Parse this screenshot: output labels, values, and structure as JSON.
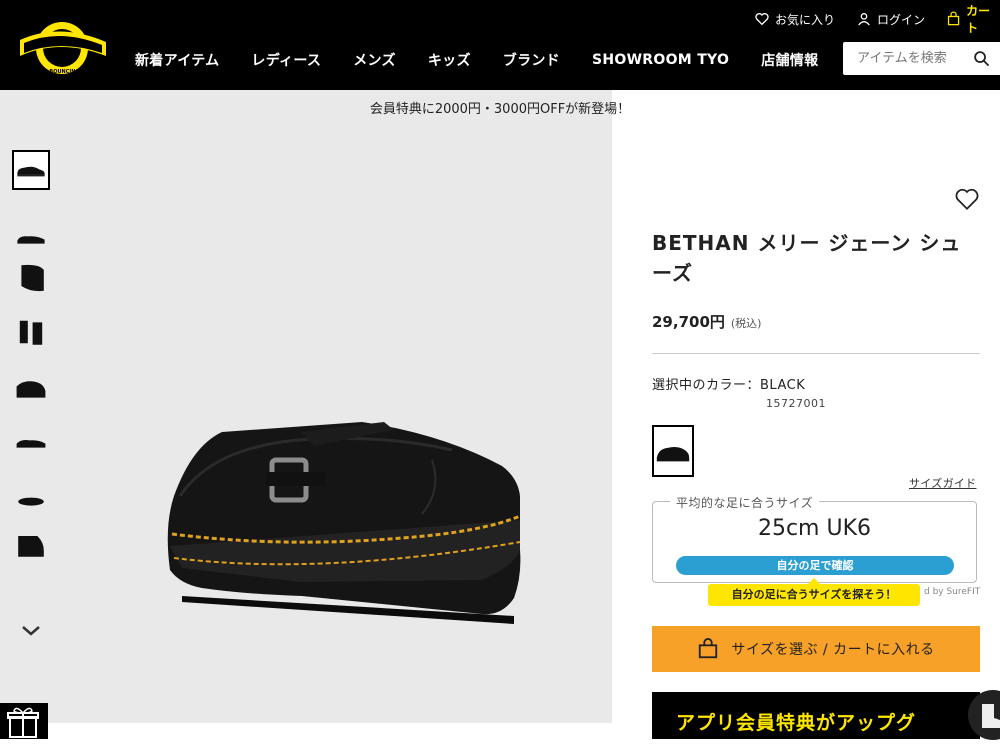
{
  "header": {
    "logo_text": "Dr. Martens AIR WAIR",
    "favorites_label": "お気に入り",
    "login_label": "ログイン",
    "cart_label": "カート",
    "nav": [
      "新着アイテム",
      "レディース",
      "メンズ",
      "キッズ",
      "ブランド",
      "SHOWROOM TYO",
      "店舗情報"
    ],
    "search_placeholder": "アイテムを検索",
    "icons": [
      "heart-icon",
      "user-icon",
      "bag-icon",
      "search-icon"
    ]
  },
  "promo": {
    "text": "会員特典に2000円・3000円OFFが新登場！"
  },
  "gallery": {
    "thumbnail_count": 8,
    "active_index": 0,
    "scroll_icon": "chevron-down-icon"
  },
  "product": {
    "title": "BETHAN メリー ジェーン シューズ",
    "price": "29,700円",
    "tax_note": "(税込)",
    "color_label": "選択中のカラー：BLACK",
    "color_code": "15727001",
    "size_guide": "サイズガイド"
  },
  "fit": {
    "legend": "平均的な足に合うサイズ",
    "size": "25cm UK6",
    "button_label": "自分の足で確認",
    "tooltip": "自分の足に合うサイズを探そう！",
    "powered_by": "d by SureFIT"
  },
  "actions": {
    "cart_button": "サイズを選ぶ / カートに入れる",
    "app_banner": "アプリ会員特典がアップグ"
  },
  "colors": {
    "header_bg": "#000000",
    "accent_yellow": "#ffe600",
    "cart_orange": "#f7a128",
    "fit_blue": "#2b9fd1",
    "gallery_bg": "#e9e9e9"
  }
}
